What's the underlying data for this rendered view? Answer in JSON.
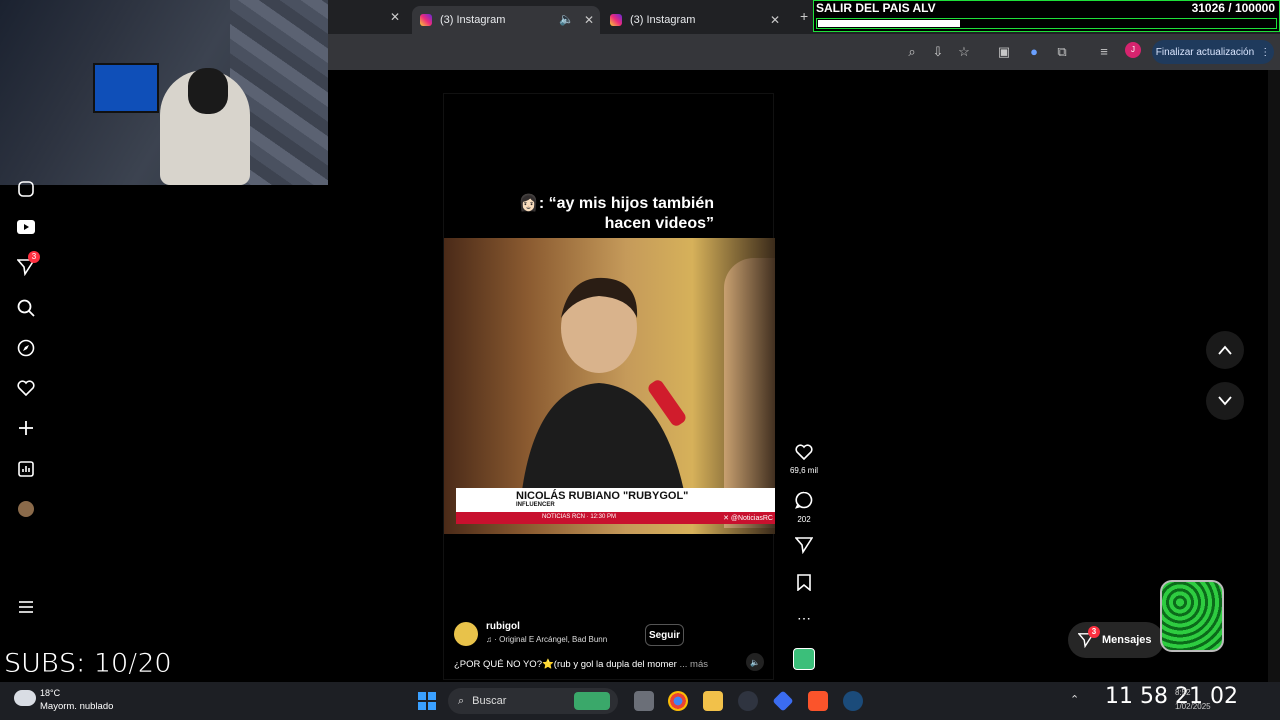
{
  "browser": {
    "tabs": [
      {
        "label": "(3) Instagram"
      },
      {
        "label": "(3) Instagram"
      }
    ],
    "update_button": "Finalizar actualización",
    "profile_initial": "J"
  },
  "goal_overlay": {
    "title": "SALIR DEL PAIS ALV",
    "count": "31026   / 100000",
    "progress_fraction": 0.31
  },
  "sidebar": {
    "notification_count": "3"
  },
  "post": {
    "overlay_caption_line1": "👩🏻: “ay mis hijos también",
    "overlay_caption_line2": "hacen videos”",
    "lower_third_name": "NICOLÁS RUBIANO \"RUBYGOL\"",
    "lower_third_sub": "INFLUENCER",
    "lower_third_strip": "NOTICIAS RCN · 12:30 PM",
    "lower_third_handle": "✕ @NoticiasRC",
    "author": "rubigol",
    "audio": "♫ · Original  E  Arcángel, Bad Bunn",
    "follow": "Seguir",
    "caption": "¿POR QUÉ NO YO?⭐(rub y gol la dupla del momer",
    "caption_more": "... más"
  },
  "actions": {
    "likes": "69,6 mil",
    "comments": "202"
  },
  "messages": {
    "label": "Mensajes",
    "count": "3"
  },
  "stream_overlay": {
    "subs": "SUBS: 10/20"
  },
  "taskbar": {
    "temperature": "18°C",
    "weather": "Mayorm. nublado",
    "search_placeholder": "Buscar",
    "clock_big": "11 58 21 02",
    "clock_time": "8:52",
    "clock_date": "1/02/2025"
  }
}
